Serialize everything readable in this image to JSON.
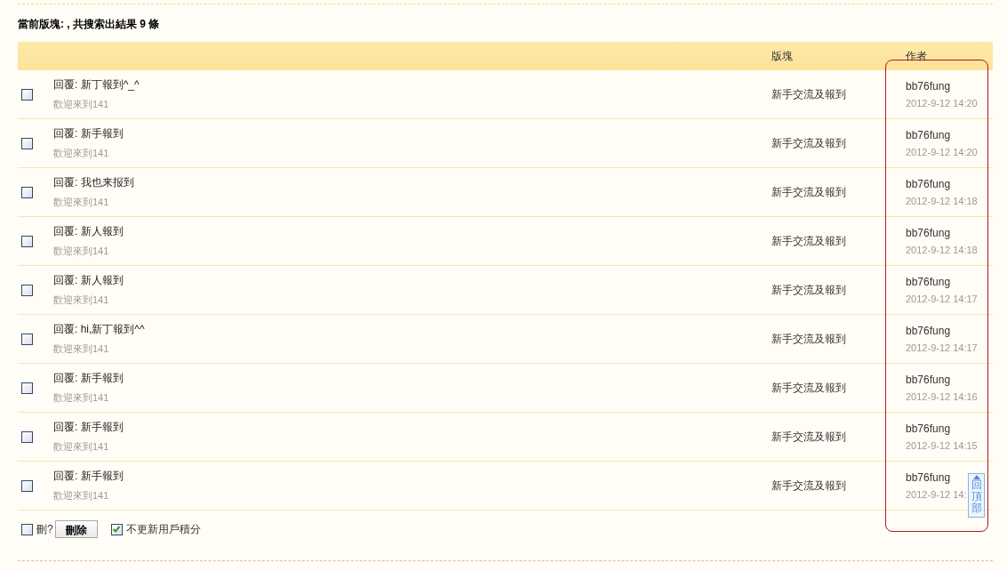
{
  "summary": "當前版塊: , 共搜索出結果 9 條",
  "table": {
    "columns": [
      "版塊",
      "作者"
    ],
    "rows": [
      {
        "checked": false,
        "title": "回覆: 新丁報到^_^",
        "excerpt": "歡迎來到141",
        "forum": "新手交流及報到",
        "author": "bb76fung",
        "date": "2012-9-12 14:20"
      },
      {
        "checked": false,
        "title": "回覆: 新手報到",
        "excerpt": "歡迎來到141",
        "forum": "新手交流及報到",
        "author": "bb76fung",
        "date": "2012-9-12 14:20"
      },
      {
        "checked": false,
        "title": "回覆: 我也来报到",
        "excerpt": "歡迎來到141",
        "forum": "新手交流及報到",
        "author": "bb76fung",
        "date": "2012-9-12 14:18"
      },
      {
        "checked": false,
        "title": "回覆: 新人報到",
        "excerpt": "歡迎來到141",
        "forum": "新手交流及報到",
        "author": "bb76fung",
        "date": "2012-9-12 14:18"
      },
      {
        "checked": false,
        "title": "回覆: 新人報到",
        "excerpt": "歡迎來到141",
        "forum": "新手交流及報到",
        "author": "bb76fung",
        "date": "2012-9-12 14:17"
      },
      {
        "checked": false,
        "title": "回覆: hi,新丁報到^^",
        "excerpt": "歡迎來到141",
        "forum": "新手交流及報到",
        "author": "bb76fung",
        "date": "2012-9-12 14:17"
      },
      {
        "checked": false,
        "title": "回覆: 新手報到",
        "excerpt": "歡迎來到141",
        "forum": "新手交流及報到",
        "author": "bb76fung",
        "date": "2012-9-12 14:16"
      },
      {
        "checked": false,
        "title": "回覆: 新手報到",
        "excerpt": "歡迎來到141",
        "forum": "新手交流及報到",
        "author": "bb76fung",
        "date": "2012-9-12 14:15"
      },
      {
        "checked": false,
        "title": "回覆: 新手報到",
        "excerpt": "歡迎來到141",
        "forum": "新手交流及報到",
        "author": "bb76fung",
        "date": "2012-9-12 14:"
      }
    ]
  },
  "footer": {
    "select_all": {
      "label": "刪?",
      "checked": false
    },
    "delete_button": "刪除",
    "keep_points": {
      "label": "不更新用戶積分",
      "checked": true
    }
  },
  "back_to_top": "回頂部"
}
